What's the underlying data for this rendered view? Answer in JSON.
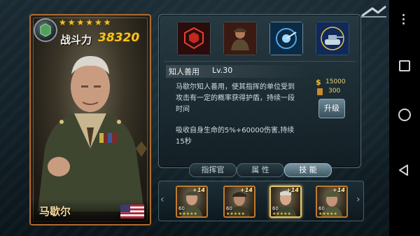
{
  "card": {
    "stars": "★★★★★★",
    "power_label": "战斗力",
    "power_value": "38320",
    "name": "马歇尔"
  },
  "skills": [
    {
      "icon": "shield-hex-icon"
    },
    {
      "icon": "soldier-icon"
    },
    {
      "icon": "radar-icon"
    },
    {
      "icon": "tank-icon"
    }
  ],
  "skill_detail": {
    "name": "知人善用",
    "level": "Lv.30",
    "description": "马歇尔知人善用，使其指挥的单位受到攻击有一定的概率获得护盾，持续一段时间",
    "effect": "吸收自身生命的5%+60000伤害,持续15秒"
  },
  "cost": {
    "money_icon": "$",
    "money": "15000",
    "medal": "300"
  },
  "upgrade_label": "升级",
  "tabs": [
    {
      "label": "指挥官",
      "selected": false
    },
    {
      "label": "属 性",
      "selected": false
    },
    {
      "label": "技 能",
      "selected": true
    }
  ],
  "generals": [
    {
      "plus": "+14",
      "level": "60",
      "stars": "★★★★★",
      "selected": false
    },
    {
      "plus": "+14",
      "level": "60",
      "stars": "★★★★★",
      "selected": false
    },
    {
      "plus": "+14",
      "level": "60",
      "stars": "★★★★★",
      "selected": true
    },
    {
      "plus": "+14",
      "level": "60",
      "stars": "★★★★★",
      "selected": false
    }
  ],
  "colors": {
    "accent_gold": "#f7c41c",
    "card_border": "#b06a2d",
    "tab_selected": "#7b96a2"
  }
}
